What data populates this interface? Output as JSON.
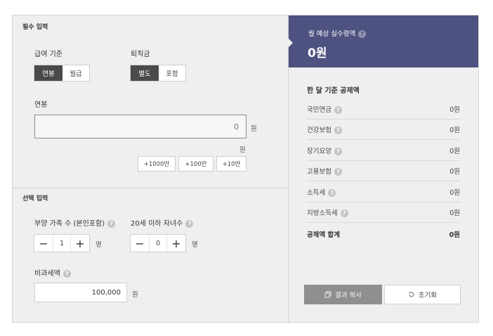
{
  "required": {
    "section_title": "필수 입력",
    "salary_basis": {
      "label": "급여 기준",
      "options": [
        "연봉",
        "월급"
      ],
      "selected": "연봉"
    },
    "severance": {
      "label": "퇴직금",
      "options": [
        "별도",
        "포함"
      ],
      "selected": "별도"
    },
    "annual": {
      "label": "연봉",
      "value": "0",
      "unit": "원",
      "sub_unit": "원"
    },
    "quick_buttons": [
      "+1000만",
      "+100만",
      "+10만"
    ]
  },
  "optional": {
    "section_title": "선택 입력",
    "dependents": {
      "label": "부양 가족 수 (본인포함)",
      "value": "1",
      "unit": "명",
      "minus": "−",
      "plus": "+"
    },
    "children": {
      "label": "20세 이하 자녀수",
      "value": "0",
      "unit": "명",
      "minus": "−",
      "plus": "+"
    },
    "nontaxable": {
      "label": "비과세액",
      "value": "100,000",
      "unit": "원"
    }
  },
  "result": {
    "title": "월 예상 실수령액",
    "value": "0원",
    "deduction_title": "한 달 기준 공제액",
    "rows": [
      {
        "label": "국민연금",
        "value": "0원"
      },
      {
        "label": "건강보험",
        "value": "0원"
      },
      {
        "label": "장기요양",
        "value": "0원"
      },
      {
        "label": "고용보험",
        "value": "0원"
      },
      {
        "label": "소득세",
        "value": "0원"
      },
      {
        "label": "지방소득세",
        "value": "0원"
      }
    ],
    "total": {
      "label": "공제액 합계",
      "value": "0원"
    },
    "copy_label": "결과 복사",
    "reset_label": "초기화"
  },
  "help_glyph": "?",
  "icons": {
    "copy": "copy-icon",
    "reset": "reset-icon",
    "help": "help-icon"
  },
  "colors": {
    "header": "#4e5280",
    "active": "#4a4a4a",
    "copy_button": "#8f8f8f"
  }
}
